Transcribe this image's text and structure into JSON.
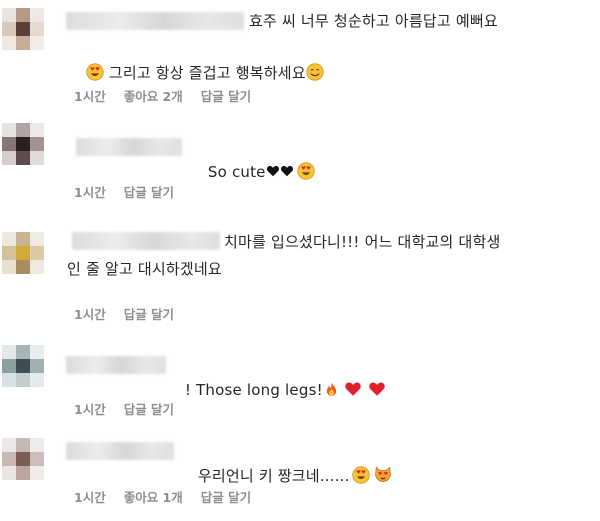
{
  "comments": [
    {
      "text_line1": "효주 씨 너무 청순하고 아름답고 예뻐요",
      "text_line2_after_emoji": " 그리고 항상 즐겁고 행복하세요",
      "meta": {
        "time": "1시간",
        "likes": "좋아요 2개",
        "reply": "답글 달기"
      }
    },
    {
      "text_line1": "So cute",
      "meta": {
        "time": "1시간",
        "reply": "답글 달기"
      }
    },
    {
      "text_line1": "치마를 입으셨다니!!! 어느 대학교의 대학생",
      "text_line2": "인 줄 알고 대시하겠네요",
      "meta": {
        "time": "1시간",
        "reply": "답글 달기"
      }
    },
    {
      "text_line1": "! Those long legs!",
      "meta": {
        "time": "1시간",
        "reply": "답글 달기"
      }
    },
    {
      "text_line1": "우리언니 키 짱크네......",
      "meta": {
        "time": "1시간",
        "likes": "좋아요 1개",
        "reply": "답글 달기"
      }
    }
  ],
  "icons": {
    "heart_eyes": "heart-eyes-emoji",
    "smiling": "smiling-face-emoji",
    "black_heart": "black-heart-emoji",
    "fire": "fire-emoji",
    "red_heart": "red-heart-emoji",
    "cat_heart_eyes": "cat-heart-eyes-emoji"
  },
  "colors": {
    "text": "#262626",
    "meta": "#8e8e8e",
    "heart": "#e0202b"
  }
}
